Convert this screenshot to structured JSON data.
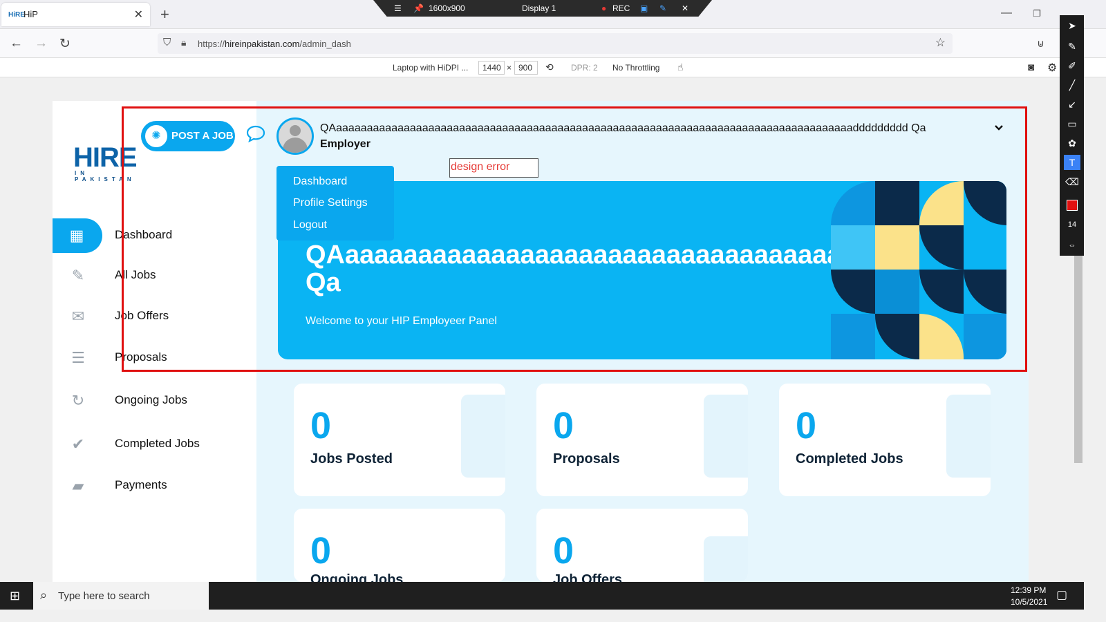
{
  "browser": {
    "tab_title": "HiP",
    "tab_favicon": "HiRE",
    "url_prefix": "https://",
    "url_domain": "hireinpakistan.com",
    "url_path": "/admin_dash",
    "recbar": {
      "resolution": "1600x900",
      "display": "Display 1",
      "rec": "REC"
    },
    "devtools": {
      "device": "Laptop with HiDPI ...",
      "width": "1440",
      "x": "×",
      "height": "900",
      "dpr": "DPR: 2",
      "throttling": "No Throttling"
    }
  },
  "logo": {
    "big": "HIRE",
    "small": "IN PAKISTAN"
  },
  "sidebar": {
    "items": [
      {
        "label": "Dashboard",
        "icon": "grid-icon"
      },
      {
        "label": "All Jobs",
        "icon": "document-edit-icon"
      },
      {
        "label": "Job Offers",
        "icon": "envelope-icon"
      },
      {
        "label": "Proposals",
        "icon": "list-doc-icon"
      },
      {
        "label": "Ongoing Jobs",
        "icon": "refresh-icon"
      },
      {
        "label": "Completed Jobs",
        "icon": "check-circle-icon"
      },
      {
        "label": "Payments",
        "icon": "wallet-icon"
      }
    ]
  },
  "header": {
    "post_job": "POST A JOB",
    "user_name": "QAaaaaaaaaaaaaaaaaaaaaaaaaaaaaaaaaaaaaaaaaaaaaaaaaaaaaaaaaaaaaaaaaaaaaaaaaaaaaaaaaaaaaddddddddd Qa",
    "user_role": "Employer"
  },
  "dropdown": {
    "items": [
      "Dashboard",
      "Profile Settings",
      "Logout"
    ]
  },
  "annotation": {
    "text": "design error"
  },
  "banner": {
    "heading_line1": "QAaaaaaaaaaaaaaaaaaaaaaaaaaaaaaaaaaaaaaaaaaaa",
    "heading_line2": "Qa",
    "subtitle": "Welcome to your HIP Employeer Panel"
  },
  "stats": [
    {
      "value": "0",
      "label": "Jobs Posted"
    },
    {
      "value": "0",
      "label": "Proposals"
    },
    {
      "value": "0",
      "label": "Completed Jobs"
    },
    {
      "value": "0",
      "label": "Ongoing Jobs"
    },
    {
      "value": "0",
      "label": "Job Offers"
    }
  ],
  "annotation_tools": {
    "font_size": "14",
    "color": "#e01010"
  },
  "taskbar": {
    "search_placeholder": "Type here to search",
    "time": "12:39 PM",
    "date": "10/5/2021"
  },
  "colors": {
    "accent": "#0aa7ee",
    "banner": "#0ab4f3",
    "navy": "#0f2336"
  }
}
